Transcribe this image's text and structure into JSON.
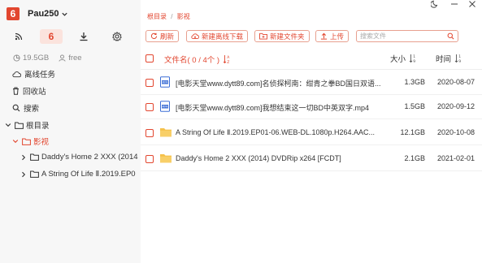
{
  "account": {
    "logo": "6",
    "name": "Pau250"
  },
  "quick": {
    "badge": "6"
  },
  "storage": {
    "used": "19.5GB",
    "free": "free"
  },
  "nav": {
    "offline": "离线任务",
    "recycle": "回收站",
    "search": "搜索",
    "root": "根目录",
    "movies": "影视"
  },
  "tree": {
    "child1": "Daddy's Home 2 XXX (2014",
    "child2": "A String Of Life Ⅱ.2019.EP0"
  },
  "breadcrumb": {
    "root": "根目录",
    "sep": "/",
    "current": "影视"
  },
  "toolbar": {
    "refresh": "刷新",
    "new_offline": "新建离线下载",
    "new_folder": "新建文件夹",
    "upload": "上传",
    "search_placeholder": "搜索文件",
    "search_value": ""
  },
  "table": {
    "col_name": "文件名( 0 / 4个 )",
    "col_size": "大小",
    "col_time": "时间",
    "rows": [
      {
        "type": "video",
        "name": "[电影天堂www.dytt89.com]名侦探柯南：绀青之拳BD国日双语...",
        "size": "1.3GB",
        "time": "2020-08-07"
      },
      {
        "type": "video",
        "name": "[电影天堂www.dytt89.com]我想结束这一切BD中英双字.mp4",
        "size": "1.5GB",
        "time": "2020-09-12"
      },
      {
        "type": "folder",
        "name": "A String Of Life Ⅱ.2019.EP01-06.WEB-DL.1080p.H264.AAC...",
        "size": "12.1GB",
        "time": "2020-10-08"
      },
      {
        "type": "folder",
        "name": "Daddy's Home 2 XXX (2014) DVDRip x264 [FCDT]",
        "size": "2.1GB",
        "time": "2021-02-01"
      }
    ]
  },
  "colors": {
    "accent": "#e2462f",
    "folder": "#f5c14a",
    "video_icon": "#3d6fd6"
  }
}
